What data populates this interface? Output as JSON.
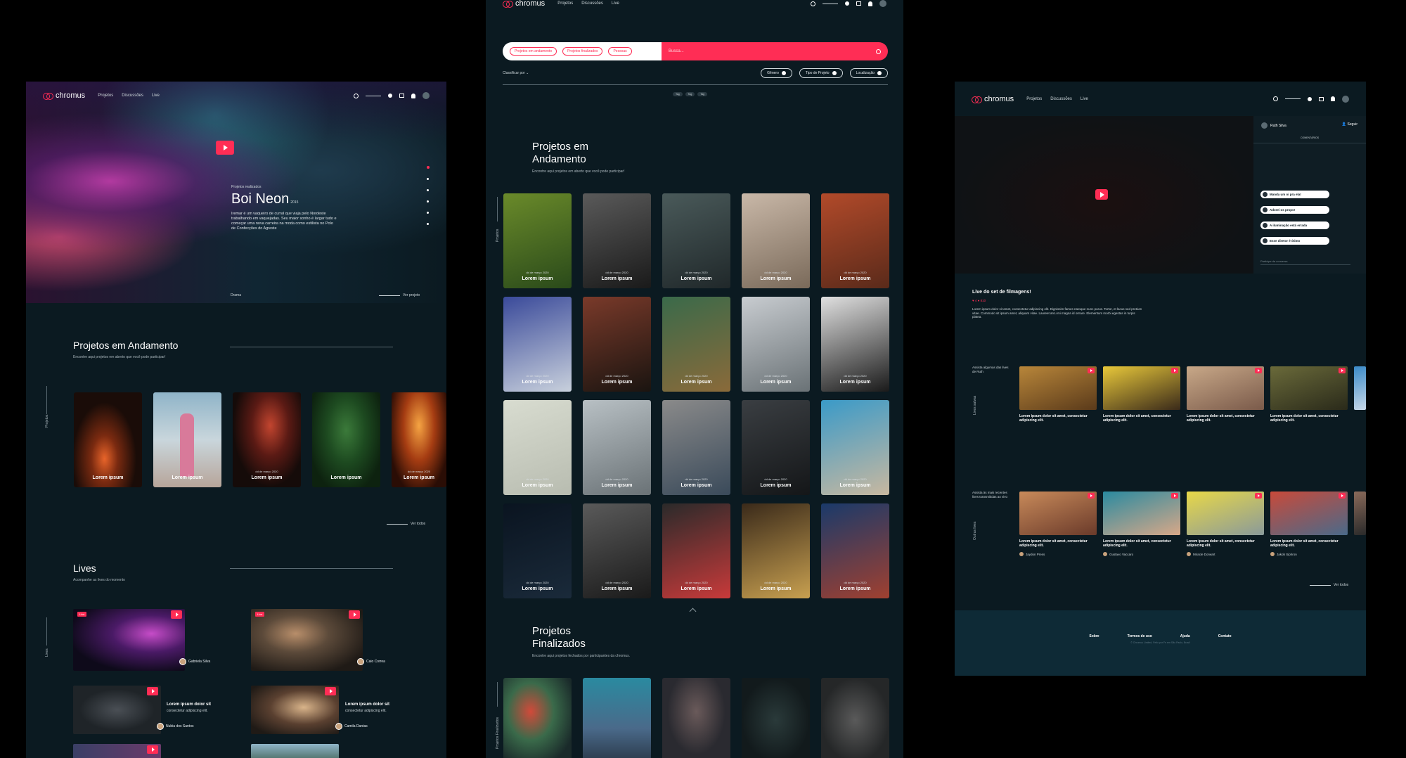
{
  "nav": {
    "logo": "chromus",
    "links": [
      "Projetos",
      "Discussões",
      "Live"
    ]
  },
  "home": {
    "hero": {
      "label": "Projetos realizados",
      "title": "Boi Neon",
      "year": "2015",
      "description": "Iremar é um vaqueiro de curral que viaja pelo Nordeste trabalhando em vaquejadas. Seu maior sonho é largar tudo e começar uma nova carreira na moda como estilista no Polo de Confecções do Agreste",
      "genre": "Drama",
      "link": "Ver projeto"
    },
    "projects": {
      "title": "Projetos em Andamento",
      "subtitle": "Encontre aqui projetos em aberto que você pode participar!",
      "side_label": "Projetos",
      "link": "Ver todos",
      "cards": [
        {
          "label": "Lorem ipsum",
          "date": ""
        },
        {
          "label": "Lorem ipsum",
          "date": ""
        },
        {
          "label": "Lorem ipsum",
          "date": "dd de março 2020"
        },
        {
          "label": "Lorem ipsum",
          "date": ""
        },
        {
          "label": "Lorem ipsum",
          "date": "dd de março 2020"
        }
      ]
    },
    "lives": {
      "title": "Lives",
      "subtitle": "Acompanhe as lives do momento",
      "side_label": "Lives",
      "badge": "Live",
      "featured": [
        {
          "user": "Gabriela Silva"
        },
        {
          "user": "Caio Correa"
        }
      ],
      "others": [
        {
          "title": "Lorem ipsum dolor sit",
          "sub": "consectetur adipiscing elit.",
          "user": "Nubia dos Santos"
        },
        {
          "title": "Lorem ipsum dolor sit",
          "sub": "consectetur adipiscing elit.",
          "user": "Camila Dantas"
        }
      ]
    }
  },
  "search": {
    "chips": [
      "Projetos em andamento",
      "Projetos finalizados",
      "Pessoas"
    ],
    "placeholder": "Busca...",
    "sort": "Classificar por",
    "filters": [
      "Gênero",
      "Tipo de Projeto",
      "Localização"
    ],
    "tags": [
      "Tag",
      "Tag",
      "Tag"
    ],
    "section1": {
      "title_line1": "Projetos em",
      "title_line2": "Andamento",
      "subtitle": "Encontre aqui projetos em aberto que você pode participar!",
      "side_label": "Projetos",
      "card_label": "Lorem ipsum",
      "card_date": "dd de março 2020"
    },
    "section2": {
      "title_line1": "Projetos",
      "title_line2": "Finalizados",
      "subtitle": "Encontre aqui projetos fechados por participantes da chromus.",
      "side_label": "Projetos Finalizados"
    }
  },
  "live_page": {
    "chat": {
      "user": "Ruth Silva",
      "follow": "Seguir",
      "tab": "COMENTÁRIOS",
      "messages": [
        "Manda um oi pra ela!",
        "Adorei os props!",
        "A iluminação está errada",
        "Esse diretor é ótimo"
      ],
      "input_placeholder": "Participe da conversa"
    },
    "title": "Live do set de filmagens!",
    "meta": "♥ 4   ● 810",
    "description": "Lorem ipsum dolor sit amet, consectetur adipiscing elit. Dignissim fames natoque nunc purus. Tortor, et lacus sed pretium vitae. Commodo sit ipsum amet, aliquam vitae. Laoreet arcu mi magna id ornare. Elementum morbi egestas in turpis platea.",
    "row1_label": "Assista algumas das lives de Ruth",
    "row1_side": "Lives salvas",
    "row2_label": "Assista às mais recentes lives transmitidas ao vivo",
    "row2_side": "Outras lives",
    "caption": "Lorem ipsum dolor sit amet, consectetur adipiscing elit.",
    "users": [
      "Jaydon Press",
      "Gustavo Vaccaro",
      "Miracle Dorwart",
      "Jakob Siphron"
    ],
    "link": "Ver todos",
    "footer": {
      "links": [
        "Sobre",
        "Termos de uso",
        "Ajuda",
        "Contato"
      ],
      "copy": "© Chromus Limited, Feito por Fe em São Paulo, Brasil"
    }
  }
}
